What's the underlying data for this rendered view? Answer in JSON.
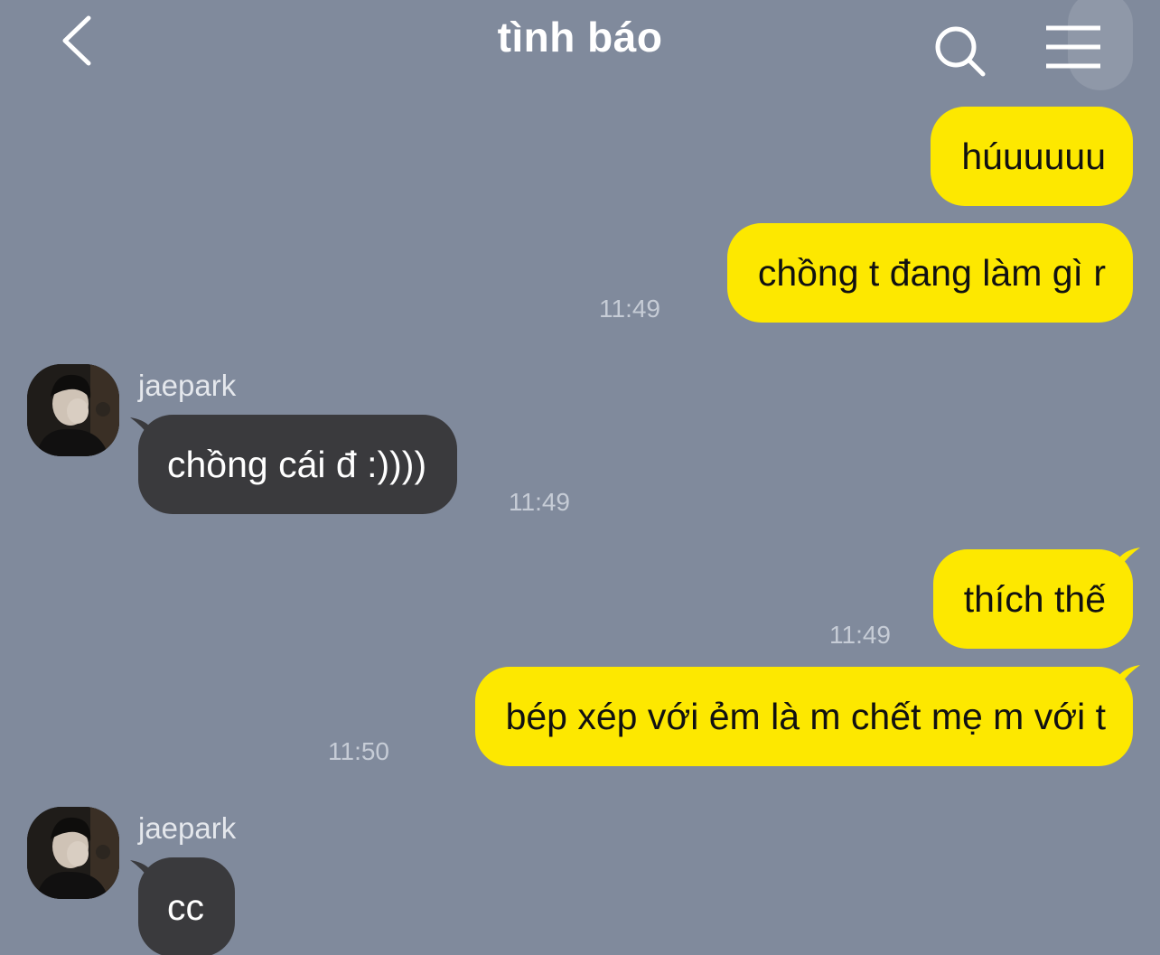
{
  "header": {
    "title": "tình báo",
    "back_icon": "chevron-left-icon",
    "search_icon": "search-icon",
    "menu_icon": "hamburger-menu-icon"
  },
  "colors": {
    "background": "#808a9c",
    "outgoing_bubble": "#fde800",
    "incoming_bubble": "#3a3a3d",
    "timestamp": "#c6ccd6"
  },
  "messages": [
    {
      "direction": "outgoing",
      "text": "húuuuuu",
      "time": ""
    },
    {
      "direction": "outgoing",
      "text": "chồng t đang làm gì r",
      "time": "11:49"
    },
    {
      "direction": "incoming",
      "sender": "jaepark",
      "text": "chồng cái đ :))))",
      "time": "11:49"
    },
    {
      "direction": "outgoing",
      "text": "thích thế",
      "time": "11:49"
    },
    {
      "direction": "outgoing",
      "text": "bép xép với ẻm là m chết mẹ m với t",
      "time": "11:50"
    },
    {
      "direction": "incoming",
      "sender": "jaepark",
      "text": "cc",
      "time": ""
    }
  ]
}
